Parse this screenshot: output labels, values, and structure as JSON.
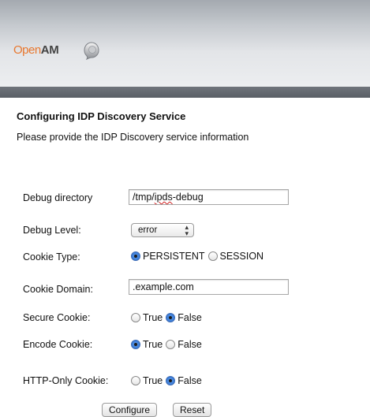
{
  "header": {
    "logo_open": "Open",
    "logo_am": "AM"
  },
  "page": {
    "title": "Configuring IDP Discovery Service",
    "subtitle": "Please provide the IDP Discovery service information"
  },
  "form": {
    "debug_directory": {
      "label": "Debug directory",
      "value": "/tmp/ipds-debug"
    },
    "debug_level": {
      "label": "Debug Level:",
      "selected": "error"
    },
    "cookie_type": {
      "label": "Cookie Type:",
      "options": [
        "PERSISTENT",
        "SESSION"
      ],
      "selected": "PERSISTENT"
    },
    "cookie_domain": {
      "label": "Cookie Domain:",
      "value": ".example.com"
    },
    "secure_cookie": {
      "label": "Secure Cookie:",
      "options": [
        "True",
        "False"
      ],
      "selected": "False"
    },
    "encode_cookie": {
      "label": "Encode Cookie:",
      "options": [
        "True",
        "False"
      ],
      "selected": "True"
    },
    "http_only_cookie": {
      "label": "HTTP-Only Cookie:",
      "options": [
        "True",
        "False"
      ],
      "selected": "False"
    }
  },
  "buttons": {
    "configure": "Configure",
    "reset": "Reset"
  },
  "colors": {
    "logo_orange": "#e8772e",
    "header_bar": "#5f646b",
    "radio_selected": "#2f6fcf"
  }
}
